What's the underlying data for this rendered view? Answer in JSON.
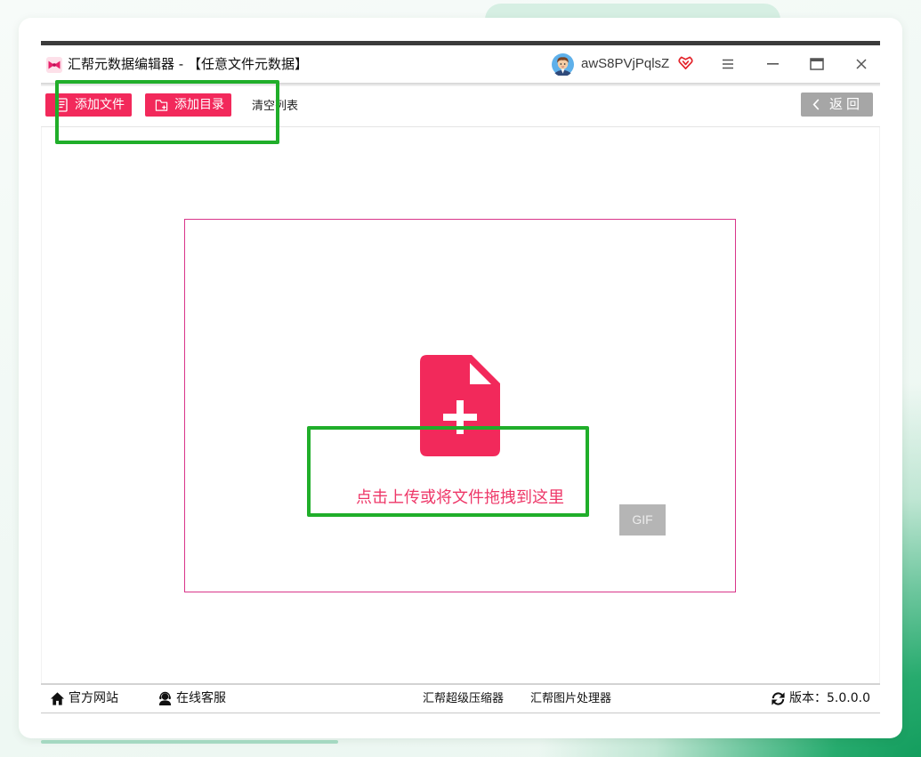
{
  "window": {
    "title": "汇帮元数据编辑器 - 【任意文件元数据】",
    "logo_icon": "app-logo-icon",
    "user": {
      "avatar_icon": "avatar-icon",
      "name": "awS8PVjPqlsZ",
      "vip_icon": "vip-heart-icon"
    },
    "controls": {
      "menu_icon": "menu-icon",
      "minimize_icon": "minimize-icon",
      "maximize_icon": "maximize-icon",
      "close_icon": "close-icon"
    }
  },
  "toolbar": {
    "add_file": {
      "label": "添加文件",
      "icon": "file-list-icon"
    },
    "add_folder": {
      "label": "添加目录",
      "icon": "folder-plus-icon"
    },
    "clear_list": {
      "label": "清空列表"
    },
    "back": {
      "label": "返回",
      "icon": "chevron-left-icon"
    }
  },
  "dropzone": {
    "icon": "file-plus-icon",
    "hint": "点击上传或将文件拖拽到这里",
    "gif_button": "GIF"
  },
  "footer": {
    "website": {
      "label": "官方网站",
      "icon": "home-icon"
    },
    "support": {
      "label": "在线客服",
      "icon": "customer-service-icon"
    },
    "compressor": {
      "label": "汇帮超级压缩器"
    },
    "image_processor": {
      "label": "汇帮图片处理器"
    },
    "version": {
      "label": "版本：5.0.0.0",
      "icon": "refresh-icon"
    }
  },
  "colors": {
    "accent": "#f2295b",
    "dropzone_border": "#d9358a",
    "hint_text": "#ee3768",
    "back_button": "#a6a6a6",
    "gif_button": "#b5b5b5",
    "highlight": "#20ae2a",
    "title_bar_top": "#3b3b3b"
  }
}
